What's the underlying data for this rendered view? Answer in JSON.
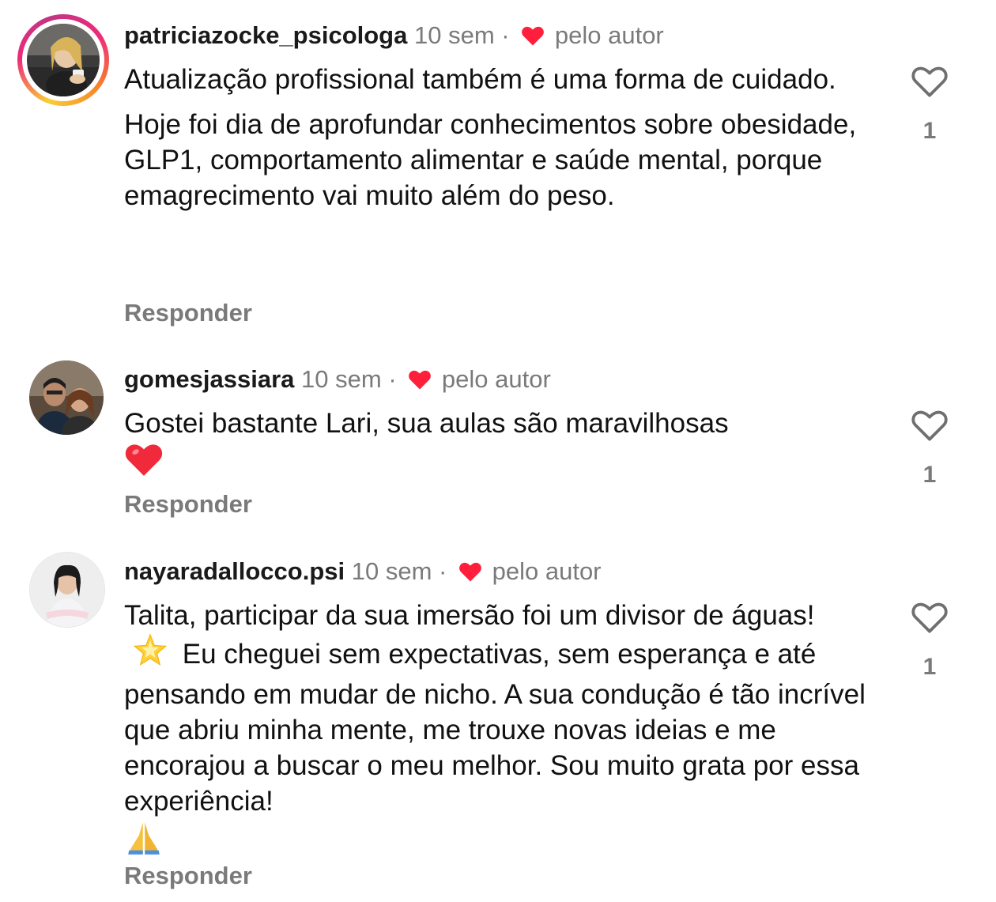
{
  "comments": [
    {
      "username": "patriciazocke_psicologa",
      "time": "10 sem",
      "separator": "·",
      "liked_by_author_label": "pelo autor",
      "paragraphs": [
        "Atualização profissional também é uma forma de cuidado.",
        "Hoje foi dia de aprofundar conhecimentos sobre obesidade, GLP1, comportamento alimentar e saúde mental, porque emagrecimento vai muito além do peso."
      ],
      "like_count": "1",
      "reply_label": "Responder"
    },
    {
      "username": "gomesjassiara",
      "time": "10 sem",
      "separator": "·",
      "liked_by_author_label": "pelo autor",
      "text_line1": "Gostei bastante Lari, sua aulas são maravilhosas",
      "text_emoji": "❤️",
      "like_count": "1",
      "reply_label": "Responder"
    },
    {
      "username": "nayaradallocco.psi",
      "time": "10 sem",
      "separator": "·",
      "liked_by_author_label": "pelo autor",
      "text_part1": "Talita, participar da sua imersão foi um divisor de águas!",
      "text_emoji1": "🌟",
      "text_part2": "Eu cheguei sem expectativas, sem esperança e até pensando em mudar de nicho. A sua condução é tão incrível que abriu minha mente, me trouxe novas ideias e me encorajou a buscar o meu melhor. Sou muito grata por essa experiência!",
      "text_emoji2": "🙏",
      "like_count": "1",
      "reply_label": "Responder"
    }
  ],
  "colors": {
    "meta": "#7a7a7a",
    "heart_red": "#ff1f3d",
    "story_ring": [
      "#f9ce34",
      "#ee2a7b",
      "#c13584"
    ]
  },
  "icons": {
    "like": "heart-outline-icon",
    "liked_by_author": "heart-filled-icon"
  }
}
